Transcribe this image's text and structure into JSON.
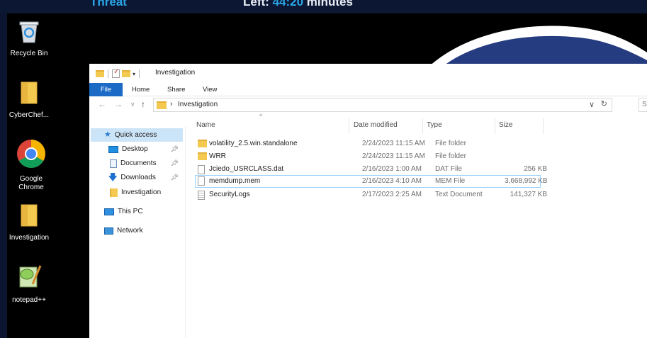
{
  "banner": {
    "title": "Threat",
    "left_prefix": "Left:",
    "left_value": "44:20",
    "left_suffix": "minutes"
  },
  "desktop_icons": [
    {
      "label": "Recycle Bin",
      "icon": "recycle-bin-icon"
    },
    {
      "label": "CyberChef...",
      "icon": "folder-icon"
    },
    {
      "label": "Google Chrome",
      "icon": "chrome-icon"
    },
    {
      "label": "Investigation",
      "icon": "folder-icon"
    },
    {
      "label": "notepad++",
      "icon": "notepad-plus-plus-icon"
    }
  ],
  "window": {
    "title": "Investigation",
    "ribbon_tabs": [
      "File",
      "Home",
      "Share",
      "View"
    ],
    "address": {
      "path": "Investigation",
      "search_placeholder": "S"
    }
  },
  "nav": {
    "quick_access": "Quick access",
    "items": [
      {
        "label": "Desktop",
        "pinned": true
      },
      {
        "label": "Documents",
        "pinned": true
      },
      {
        "label": "Downloads",
        "pinned": true
      },
      {
        "label": "Investigation",
        "pinned": false
      }
    ],
    "this_pc": "This PC",
    "network": "Network"
  },
  "columns": {
    "name": "Name",
    "date": "Date modified",
    "type": "Type",
    "size": "Size"
  },
  "files": [
    {
      "name": "volatility_2.5.win.standalone",
      "date": "2/24/2023 11:15 AM",
      "type": "File folder",
      "size": "",
      "icon": "folder-icon"
    },
    {
      "name": "WRR",
      "date": "2/24/2023 11:15 AM",
      "type": "File folder",
      "size": "",
      "icon": "folder-icon"
    },
    {
      "name": "Jciedo_USRCLASS.dat",
      "date": "2/16/2023 1:00 AM",
      "type": "DAT File",
      "size": "256 KB",
      "icon": "file-icon"
    },
    {
      "name": "memdump.mem",
      "date": "2/16/2023 4:10 AM",
      "type": "MEM File",
      "size": "3,668,992 KB",
      "icon": "file-icon"
    },
    {
      "name": "SecurityLogs",
      "date": "2/17/2023 2:25 AM",
      "type": "Text Document",
      "size": "141,327 KB",
      "icon": "text-file-icon"
    }
  ],
  "colors": {
    "ribbon_file": "#1a6ac6",
    "selected": "#cce4f7",
    "banner_accent": "#2aa6e6"
  }
}
